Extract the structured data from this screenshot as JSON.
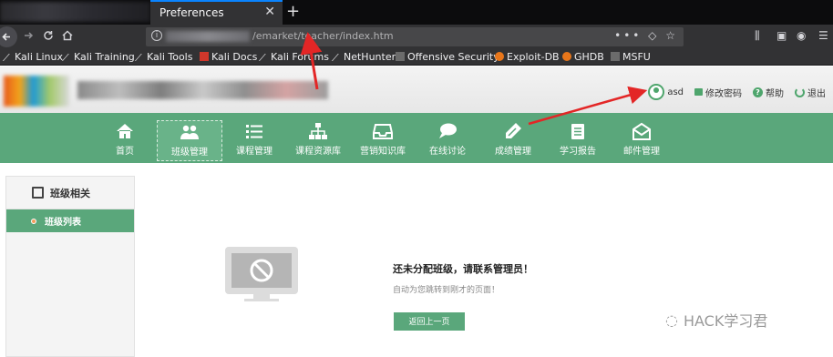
{
  "browser": {
    "tab": {
      "title": "Preferences",
      "close_icon": "close-icon",
      "new_tab_label": "+"
    },
    "url": {
      "visible_text": "/emarket/teacher/index.htm",
      "actions_label": "•••"
    },
    "bookmarks": [
      {
        "label": "Kali Linux",
        "icon": "kali-dragon-icon"
      },
      {
        "label": "Kali Training",
        "icon": "kali-dragon-icon"
      },
      {
        "label": "Kali Tools",
        "icon": "kali-dragon-icon"
      },
      {
        "label": "Kali Docs",
        "icon": "kali-docs-icon"
      },
      {
        "label": "Kali Forums",
        "icon": "kali-dragon-icon"
      },
      {
        "label": "NetHunter",
        "icon": "kali-dragon-icon"
      },
      {
        "label": "Offensive Security",
        "icon": "offsec-icon"
      },
      {
        "label": "Exploit-DB",
        "icon": "exploitdb-icon"
      },
      {
        "label": "GHDB",
        "icon": "exploitdb-icon"
      },
      {
        "label": "MSFU",
        "icon": "offsec-icon"
      }
    ]
  },
  "header": {
    "user_links": [
      {
        "label": "asd",
        "icon": "user-avatar-icon"
      },
      {
        "label": "修改密码",
        "icon": "lock-icon"
      },
      {
        "label": "帮助",
        "icon": "help-icon"
      },
      {
        "label": "退出",
        "icon": "power-icon"
      }
    ]
  },
  "main_nav": {
    "items": [
      {
        "label": "首页",
        "icon": "home-icon"
      },
      {
        "label": "班级管理",
        "icon": "class-people-icon",
        "active": true
      },
      {
        "label": "课程管理",
        "icon": "list-icon"
      },
      {
        "label": "课程资源库",
        "icon": "hierarchy-icon"
      },
      {
        "label": "营销知识库",
        "icon": "inbox-icon"
      },
      {
        "label": "在线讨论",
        "icon": "chat-bubble-icon"
      },
      {
        "label": "成绩管理",
        "icon": "pencil-icon"
      },
      {
        "label": "学习报告",
        "icon": "clipboard-icon"
      },
      {
        "label": "邮件管理",
        "icon": "mail-icon"
      }
    ]
  },
  "sidebar": {
    "section_title": "班级相关",
    "items": [
      {
        "label": "班级列表",
        "active": true
      }
    ]
  },
  "content": {
    "message_title": "还未分配班级，请联系管理员！",
    "message_sub": "自动为您跳转到刚才的页面！",
    "back_button": "返回上一页"
  },
  "watermark": {
    "text": "HACK学习君"
  },
  "colors": {
    "accent_green": "#5aa77b",
    "annotation_red": "#e32626",
    "browser_dark": "#323234"
  }
}
